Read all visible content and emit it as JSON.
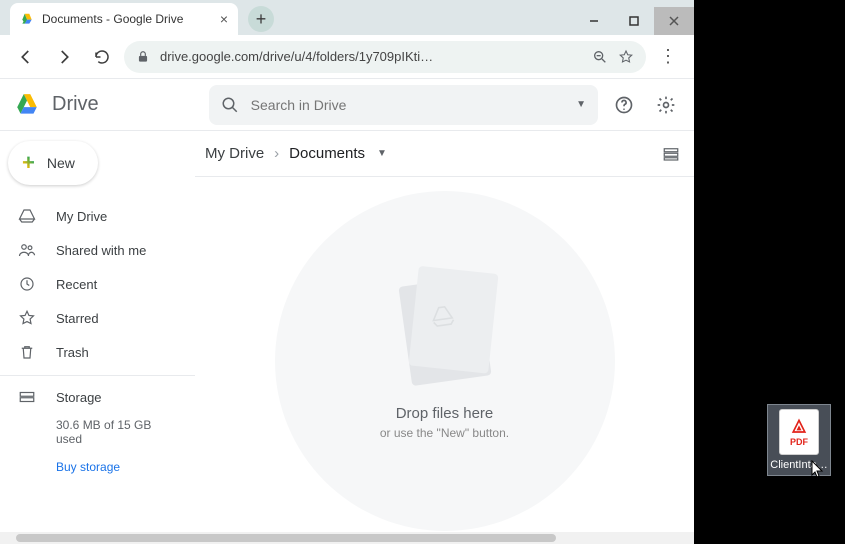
{
  "window": {
    "tab_title": "Documents - Google Drive",
    "url": "drive.google.com/drive/u/4/folders/1y709pIKti…"
  },
  "header": {
    "product_name": "Drive",
    "search_placeholder": "Search in Drive"
  },
  "sidebar": {
    "new_label": "New",
    "items": [
      {
        "label": "My Drive"
      },
      {
        "label": "Shared with me"
      },
      {
        "label": "Recent"
      },
      {
        "label": "Starred"
      },
      {
        "label": "Trash"
      }
    ],
    "storage_label": "Storage",
    "storage_used": "30.6 MB of 15 GB used",
    "buy_label": "Buy storage"
  },
  "breadcrumb": {
    "root": "My Drive",
    "current": "Documents"
  },
  "empty": {
    "title": "Drop files here",
    "subtitle": "or use the \"New\" button."
  },
  "desktop": {
    "filename": "ClientInta…",
    "file_type": "PDF"
  }
}
